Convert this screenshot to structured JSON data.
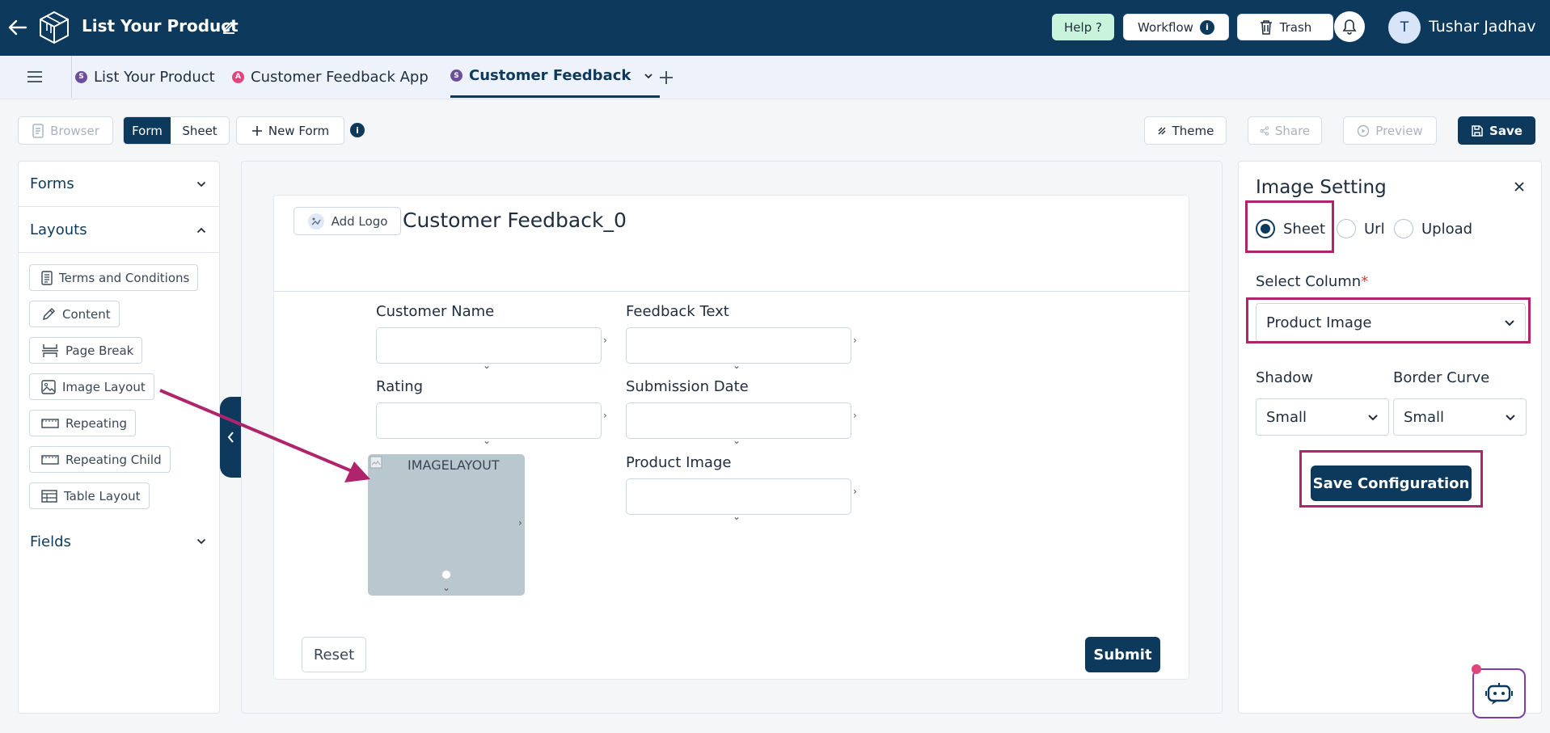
{
  "header": {
    "title": "List Your Product",
    "help_label": "Help ?",
    "workflow_label": "Workflow",
    "trash_label": "Trash",
    "user_initial": "T",
    "user_name": "Tushar Jadhav"
  },
  "tabs": [
    {
      "badge": "S",
      "label": "List Your Product",
      "badge_color": "#6b4ea0"
    },
    {
      "badge": "A",
      "label": "Customer Feedback App",
      "badge_color": "#e0457b"
    },
    {
      "badge": "S",
      "label": "Customer Feedback",
      "badge_color": "#6b4ea0",
      "active": true
    }
  ],
  "toolbar": {
    "browser_label": "Browser",
    "form_label": "Form",
    "sheet_label": "Sheet",
    "new_form_label": "New Form",
    "theme_label": "Theme",
    "share_label": "Share",
    "preview_label": "Preview",
    "save_label": "Save"
  },
  "left_panel": {
    "forms_label": "Forms",
    "layouts_label": "Layouts",
    "fields_label": "Fields",
    "layout_items": [
      "Terms and Conditions",
      "Content",
      "Page Break",
      "Image Layout",
      "Repeating",
      "Repeating Child",
      "Table Layout"
    ]
  },
  "form": {
    "add_logo_label": "Add Logo",
    "title": "Customer Feedback_0",
    "fields": [
      "Customer Name",
      "Feedback Text",
      "Rating",
      "Submission Date",
      "Product Image"
    ],
    "image_placeholder": "IMAGELAYOUT",
    "reset_label": "Reset",
    "submit_label": "Submit"
  },
  "image_setting": {
    "title": "Image Setting",
    "source_options": [
      "Sheet",
      "Url",
      "Upload"
    ],
    "selected_source": "Sheet",
    "select_column_label": "Select Column",
    "required_mark": "*",
    "selected_column": "Product Image",
    "shadow_label": "Shadow",
    "shadow_value": "Small",
    "border_curve_label": "Border Curve",
    "border_curve_value": "Small",
    "save_config_label": "Save Configuration"
  },
  "colors": {
    "primary": "#0d3a5c",
    "highlight": "#b0246c",
    "help_bg": "#c9f3da",
    "image_placeholder_bg": "#b9c8cf"
  }
}
